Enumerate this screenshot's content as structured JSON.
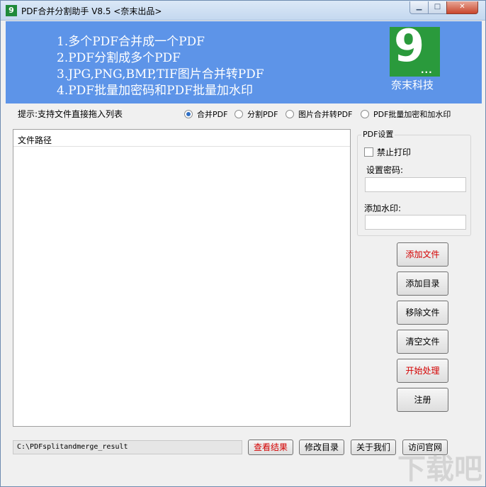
{
  "window": {
    "icon_text": "9",
    "title": "PDF合并分割助手 V8.5 <奈末出品>",
    "min_glyph": "▁",
    "max_glyph": "□",
    "close_glyph": "✕"
  },
  "banner": {
    "features": [
      "1.多个PDF合并成一个PDF",
      "2.PDF分割成多个PDF",
      "3.JPG,PNG,BMP,TIF图片合并转PDF",
      "4.PDF批量加密码和PDF批量加水印"
    ],
    "logo_mark": "9",
    "logo_dots": "...",
    "logo_text": "奈末科技"
  },
  "tip": "提示:支持文件直接拖入列表",
  "modes": [
    {
      "label": "合并PDF",
      "selected": true
    },
    {
      "label": "分割PDF",
      "selected": false
    },
    {
      "label": "图片合并转PDF",
      "selected": false
    },
    {
      "label": "PDF批量加密和加水印",
      "selected": false
    }
  ],
  "file_list": {
    "column_header": "文件路径"
  },
  "settings": {
    "legend": "PDF设置",
    "disable_print_label": "禁止打印",
    "disable_print_checked": false,
    "password_label": "设置密码:",
    "password_value": "",
    "watermark_label": "添加水印:",
    "watermark_value": ""
  },
  "actions": {
    "add_file": "添加文件",
    "add_dir": "添加目录",
    "remove_file": "移除文件",
    "clear_files": "清空文件",
    "start": "开始处理",
    "register": "注册"
  },
  "bottom": {
    "output_path": "C:\\PDFsplitandmerge_result",
    "view_result": "查看结果",
    "change_dir": "修改目录",
    "about": "关于我们",
    "visit_site": "访问官网"
  },
  "watermark_overlay": "下载吧",
  "colors": {
    "banner": "#5d94e8",
    "logo": "#2a9a3c",
    "accent_red": "#d40000"
  }
}
